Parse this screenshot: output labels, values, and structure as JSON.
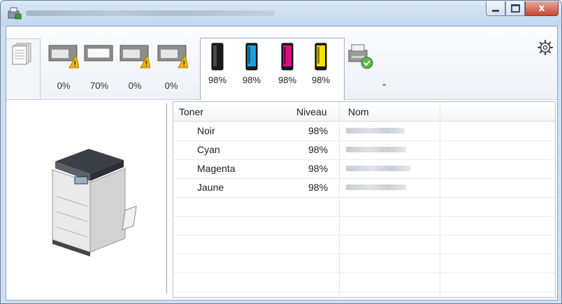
{
  "window": {
    "close_glyph": "x"
  },
  "trays": [
    {
      "name": "tray-1",
      "level": "0%",
      "warning": true
    },
    {
      "name": "tray-2",
      "level": "70%",
      "warning": false
    },
    {
      "name": "tray-3",
      "level": "0%",
      "warning": true
    },
    {
      "name": "tray-4",
      "level": "0%",
      "warning": true
    }
  ],
  "toners": [
    {
      "color_name": "black",
      "color": "#1a1a1a",
      "level": "98%"
    },
    {
      "color_name": "cyan",
      "color": "#1aa0dc",
      "level": "98%"
    },
    {
      "color_name": "magenta",
      "color": "#d8117e",
      "level": "98%"
    },
    {
      "color_name": "yellow",
      "color": "#f2e000",
      "level": "98%"
    }
  ],
  "toolbar": {
    "collapse_glyph": "⌃",
    "icons": [
      "document-stack-icon",
      "printer-status-ok-icon",
      "chevron-up-icon",
      "gear-icon"
    ]
  },
  "table": {
    "columns": [
      "Toner",
      "Niveau",
      "Nom"
    ],
    "rows": [
      {
        "toner": "Noir",
        "level": "98%"
      },
      {
        "toner": "Cyan",
        "level": "98%"
      },
      {
        "toner": "Magenta",
        "level": "98%"
      },
      {
        "toner": "Jaune",
        "level": "98%"
      }
    ]
  }
}
